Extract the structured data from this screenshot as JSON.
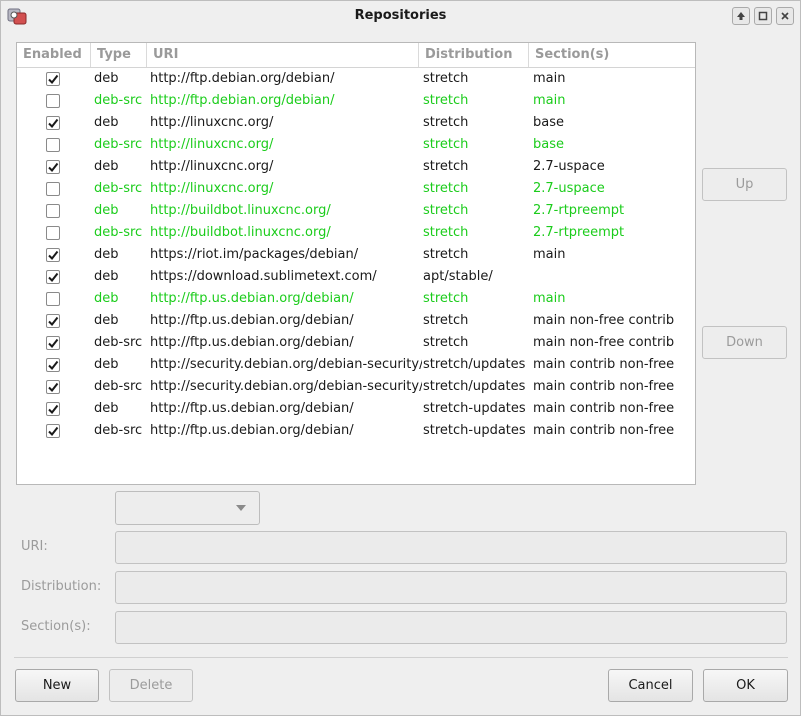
{
  "window": {
    "title": "Repositories"
  },
  "columns": [
    "Enabled",
    "Type",
    "URI",
    "Distribution",
    "Section(s)"
  ],
  "rows": [
    {
      "enabled": true,
      "type": "deb",
      "uri": "http://ftp.debian.org/debian/",
      "dist": "stretch",
      "sections": "main"
    },
    {
      "enabled": false,
      "type": "deb-src",
      "uri": "http://ftp.debian.org/debian/",
      "dist": "stretch",
      "sections": "main"
    },
    {
      "enabled": true,
      "type": "deb",
      "uri": "http://linuxcnc.org/",
      "dist": "stretch",
      "sections": "base"
    },
    {
      "enabled": false,
      "type": "deb-src",
      "uri": "http://linuxcnc.org/",
      "dist": "stretch",
      "sections": "base"
    },
    {
      "enabled": true,
      "type": "deb",
      "uri": "http://linuxcnc.org/",
      "dist": "stretch",
      "sections": "2.7-uspace"
    },
    {
      "enabled": false,
      "type": "deb-src",
      "uri": "http://linuxcnc.org/",
      "dist": "stretch",
      "sections": "2.7-uspace"
    },
    {
      "enabled": false,
      "type": "deb",
      "uri": "http://buildbot.linuxcnc.org/",
      "dist": "stretch",
      "sections": "2.7-rtpreempt"
    },
    {
      "enabled": false,
      "type": "deb-src",
      "uri": "http://buildbot.linuxcnc.org/",
      "dist": "stretch",
      "sections": "2.7-rtpreempt"
    },
    {
      "enabled": true,
      "type": "deb",
      "uri": "https://riot.im/packages/debian/",
      "dist": "stretch",
      "sections": "main"
    },
    {
      "enabled": true,
      "type": "deb",
      "uri": "https://download.sublimetext.com/",
      "dist": "apt/stable/",
      "sections": ""
    },
    {
      "enabled": false,
      "type": "deb",
      "uri": "http://ftp.us.debian.org/debian/",
      "dist": "stretch",
      "sections": "main"
    },
    {
      "enabled": true,
      "type": "deb",
      "uri": "http://ftp.us.debian.org/debian/",
      "dist": "stretch",
      "sections": "main non-free contrib"
    },
    {
      "enabled": true,
      "type": "deb-src",
      "uri": "http://ftp.us.debian.org/debian/",
      "dist": "stretch",
      "sections": "main non-free contrib"
    },
    {
      "enabled": true,
      "type": "deb",
      "uri": "http://security.debian.org/debian-security/",
      "dist": "stretch/updates",
      "sections": "main contrib non-free"
    },
    {
      "enabled": true,
      "type": "deb-src",
      "uri": "http://security.debian.org/debian-security/",
      "dist": "stretch/updates",
      "sections": "main contrib non-free"
    },
    {
      "enabled": true,
      "type": "deb",
      "uri": "http://ftp.us.debian.org/debian/",
      "dist": "stretch-updates",
      "sections": "main contrib non-free"
    },
    {
      "enabled": true,
      "type": "deb-src",
      "uri": "http://ftp.us.debian.org/debian/",
      "dist": "stretch-updates",
      "sections": "main contrib non-free"
    }
  ],
  "side_buttons": {
    "up": "Up",
    "down": "Down"
  },
  "form": {
    "type_value": "",
    "uri_label": "URI:",
    "uri_value": "",
    "dist_label": "Distribution:",
    "dist_value": "",
    "sections_label": "Section(s):",
    "sections_value": ""
  },
  "bottom_buttons": {
    "new": "New",
    "delete": "Delete",
    "cancel": "Cancel",
    "ok": "OK"
  },
  "colors": {
    "disabled_row": "#1bcc1b",
    "enabled_row": "#1a1a1a"
  },
  "icons": {
    "app": "repositories-app-icon",
    "check": "checkmark-icon",
    "dropdown": "chevron-down-icon"
  }
}
